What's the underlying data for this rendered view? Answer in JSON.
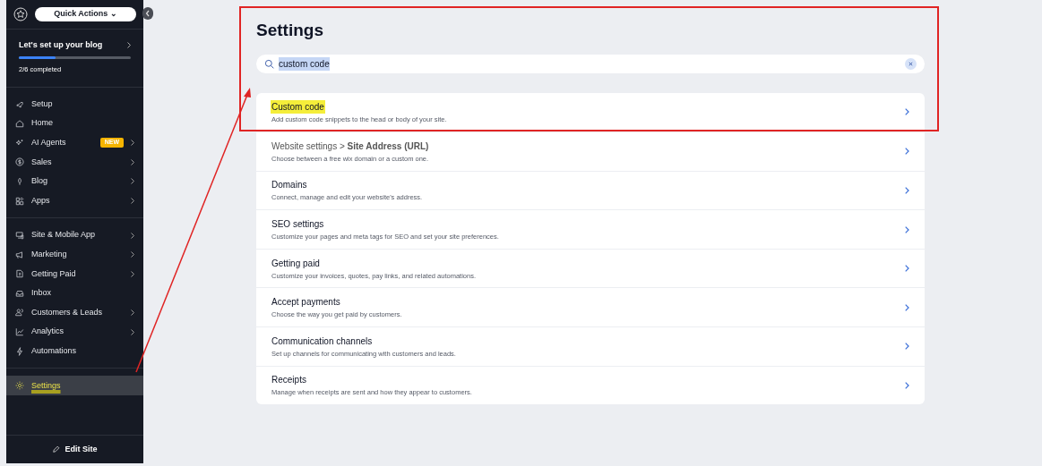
{
  "sidebar": {
    "quick_actions": "Quick Actions ⌄",
    "setup": {
      "title": "Let's set up your blog",
      "level": 0.33,
      "status": "2/6 completed"
    },
    "groups": [
      [
        {
          "label": "Setup",
          "chevron": false,
          "selected": false,
          "highlighted": false
        },
        {
          "label": "Home",
          "chevron": false,
          "selected": false,
          "highlighted": false
        },
        {
          "label": "AI Agents",
          "badge": "NEW",
          "chevron": true,
          "selected": false,
          "highlighted": false
        },
        {
          "label": "Sales",
          "chevron": true,
          "selected": false,
          "highlighted": false
        },
        {
          "label": "Blog",
          "chevron": true,
          "selected": false,
          "highlighted": false
        },
        {
          "label": "Apps",
          "chevron": true,
          "selected": false,
          "highlighted": false
        }
      ],
      [
        {
          "label": "Site & Mobile App",
          "chevron": true,
          "selected": false,
          "highlighted": false
        },
        {
          "label": "Marketing",
          "chevron": true,
          "selected": false,
          "highlighted": false
        },
        {
          "label": "Getting Paid",
          "chevron": true,
          "selected": false,
          "highlighted": false
        },
        {
          "label": "Inbox",
          "chevron": false,
          "selected": false,
          "highlighted": false
        },
        {
          "label": "Customers & Leads",
          "chevron": true,
          "selected": false,
          "highlighted": false
        },
        {
          "label": "Analytics",
          "chevron": true,
          "selected": false,
          "highlighted": false
        },
        {
          "label": "Automations",
          "chevron": false,
          "selected": false,
          "highlighted": false
        }
      ],
      [
        {
          "label": "Settings",
          "chevron": false,
          "selected": true,
          "highlighted": true
        }
      ]
    ],
    "edit_site": "Edit Site"
  },
  "page": {
    "title": "Settings",
    "search": {
      "value": "custom code",
      "selected_text": true
    },
    "results": [
      {
        "title": "Custom code",
        "description": "Add custom code snippets to the head or body of your site.",
        "highlighted": true
      },
      {
        "title": "Website settings > **Site Address (URL)**",
        "description": "Choose between a free wix domain or a custom one.",
        "highlighted": false
      },
      {
        "title": "Domains",
        "description": "Connect, manage and edit your website's address.",
        "highlighted": false
      },
      {
        "title": "SEO settings",
        "description": "Customize your pages and meta tags for SEO and set your site preferences.",
        "highlighted": false
      },
      {
        "title": "Getting paid",
        "description": "Customize your invoices, quotes, pay links, and related automations.",
        "highlighted": false
      },
      {
        "title": "Accept payments",
        "description": "Choose the way you get paid by customers.",
        "highlighted": false
      },
      {
        "title": "Communication channels",
        "description": "Set up channels for communicating with customers and leads.",
        "highlighted": false
      },
      {
        "title": "Receipts",
        "description": "Manage when receipts are sent and how they appear to customers.",
        "highlighted": false
      }
    ]
  }
}
